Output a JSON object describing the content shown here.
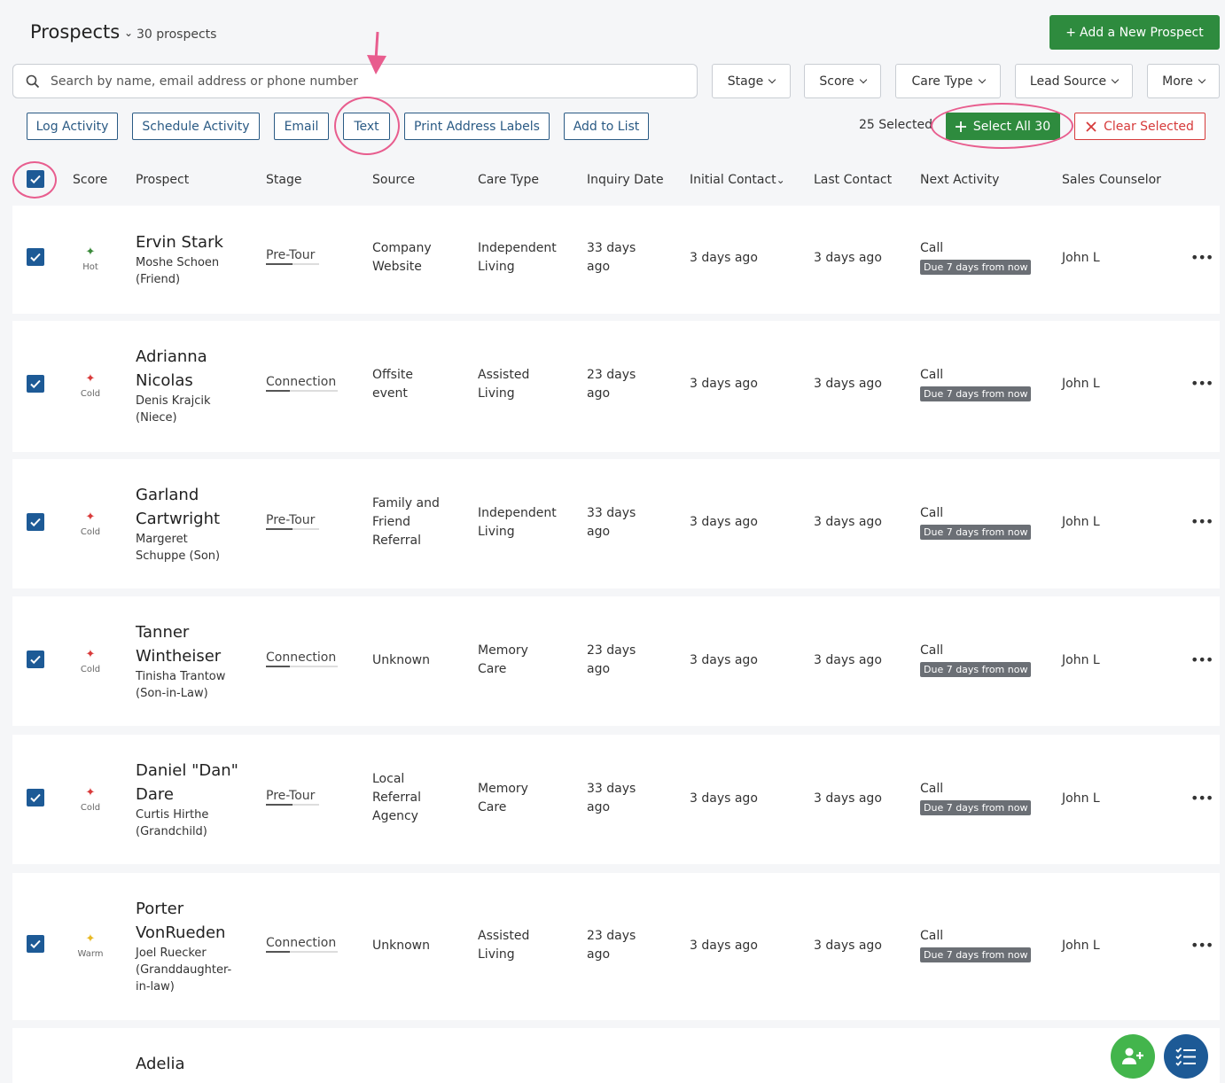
{
  "header": {
    "title": "Prospects",
    "count": "30 prospects",
    "add_button": "Add a New Prospect",
    "add_button_icon": "+"
  },
  "search": {
    "placeholder": "Search by name, email address or phone number"
  },
  "filters": [
    {
      "label": "Stage"
    },
    {
      "label": "Score"
    },
    {
      "label": "Care Type"
    },
    {
      "label": "Lead Source"
    },
    {
      "label": "More"
    }
  ],
  "actions": {
    "log_activity": "Log Activity",
    "schedule_activity": "Schedule Activity",
    "email": "Email",
    "text": "Text",
    "print_labels": "Print Address Labels",
    "add_to_list": "Add to List",
    "selected_count": "25 Selected",
    "select_all": "Select All 30",
    "clear_selected": "Clear Selected"
  },
  "table": {
    "headers": {
      "score": "Score",
      "prospect": "Prospect",
      "stage": "Stage",
      "source": "Source",
      "care_type": "Care Type",
      "inquiry_date": "Inquiry Date",
      "initial_contact": "Initial Contact",
      "last_contact": "Last Contact",
      "next_activity": "Next Activity",
      "sales_counselor": "Sales Counselor"
    },
    "rows": [
      {
        "score": "Hot",
        "score_color": "#3a8a3a",
        "name1": "Ervin Stark",
        "name2": "",
        "rel1": "Moshe Schoen",
        "rel2": "(Friend)",
        "rel3": "",
        "stage": "Pre-Tour",
        "progress": 0.5,
        "source": [
          "Company",
          "Website",
          ""
        ],
        "care": [
          "Independent",
          "Living"
        ],
        "inquiry": [
          "33 days",
          "ago"
        ],
        "initial": "3 days ago",
        "last": "3 days ago",
        "activity": "Call",
        "due": "Due 7 days from now",
        "counselor": "John L"
      },
      {
        "score": "Cold",
        "score_color": "#d93a3a",
        "name1": "Adrianna",
        "name2": "Nicolas",
        "rel1": "Denis Krajcik",
        "rel2": "(Niece)",
        "rel3": "",
        "stage": "Connection",
        "progress": 0.33,
        "source": [
          "Offsite",
          "event",
          ""
        ],
        "care": [
          "Assisted",
          "Living"
        ],
        "inquiry": [
          "23 days",
          "ago"
        ],
        "initial": "3 days ago",
        "last": "3 days ago",
        "activity": "Call",
        "due": "Due 7 days from now",
        "counselor": "John L"
      },
      {
        "score": "Cold",
        "score_color": "#d93a3a",
        "name1": "Garland",
        "name2": "Cartwright",
        "rel1": "Margeret",
        "rel2": "Schuppe (Son)",
        "rel3": "",
        "stage": "Pre-Tour",
        "progress": 0.5,
        "source": [
          "Family and",
          "Friend",
          "Referral"
        ],
        "care": [
          "Independent",
          "Living"
        ],
        "inquiry": [
          "33 days",
          "ago"
        ],
        "initial": "3 days ago",
        "last": "3 days ago",
        "activity": "Call",
        "due": "Due 7 days from now",
        "counselor": "John L"
      },
      {
        "score": "Cold",
        "score_color": "#d93a3a",
        "name1": "Tanner",
        "name2": "Wintheiser",
        "rel1": "Tinisha Trantow",
        "rel2": "(Son-in-Law)",
        "rel3": "",
        "stage": "Connection",
        "progress": 0.33,
        "source": [
          "Unknown",
          "",
          ""
        ],
        "care": [
          "Memory",
          "Care"
        ],
        "inquiry": [
          "23 days",
          "ago"
        ],
        "initial": "3 days ago",
        "last": "3 days ago",
        "activity": "Call",
        "due": "Due 7 days from now",
        "counselor": "John L"
      },
      {
        "score": "Cold",
        "score_color": "#d93a3a",
        "name1": "Daniel \"Dan\"",
        "name2": "Dare",
        "rel1": "Curtis Hirthe",
        "rel2": "(Grandchild)",
        "rel3": "",
        "stage": "Pre-Tour",
        "progress": 0.5,
        "source": [
          "Local",
          "Referral",
          "Agency"
        ],
        "care": [
          "Memory",
          "Care"
        ],
        "inquiry": [
          "33 days",
          "ago"
        ],
        "initial": "3 days ago",
        "last": "3 days ago",
        "activity": "Call",
        "due": "Due 7 days from now",
        "counselor": "John L"
      },
      {
        "score": "Warm",
        "score_color": "#e8b923",
        "name1": "Porter",
        "name2": "VonRueden",
        "rel1": "Joel Ruecker",
        "rel2": "(Granddaughter-",
        "rel3": "in-law)",
        "stage": "Connection",
        "progress": 0.33,
        "source": [
          "Unknown",
          "",
          ""
        ],
        "care": [
          "Assisted",
          "Living"
        ],
        "inquiry": [
          "23 days",
          "ago"
        ],
        "initial": "3 days ago",
        "last": "3 days ago",
        "activity": "Call",
        "due": "Due 7 days from now",
        "counselor": "John L"
      },
      {
        "name1": "Adelia"
      }
    ]
  },
  "colors": {
    "primary_green": "#2e8b3e",
    "primary_blue": "#1d5a96",
    "danger_red": "#d63a3a",
    "annotation_pink": "#e85d8e"
  }
}
